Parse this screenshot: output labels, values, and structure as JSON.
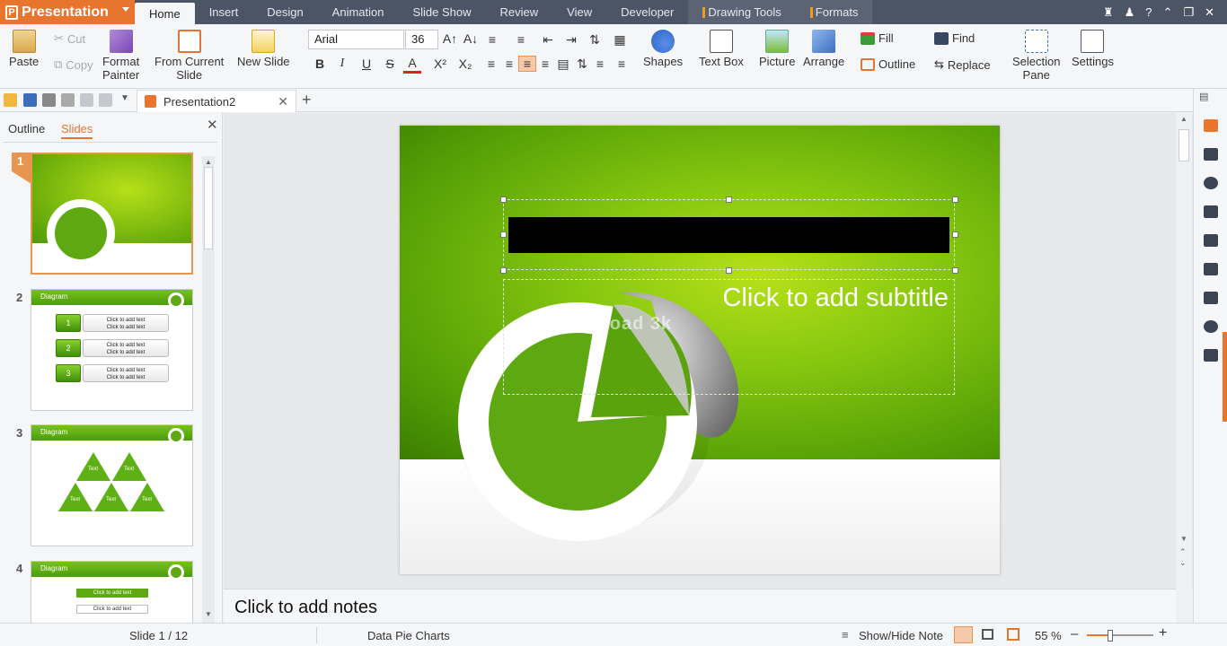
{
  "menubar": {
    "app_name": "Presentation",
    "tabs": [
      "Home",
      "Insert",
      "Design",
      "Animation",
      "Slide Show",
      "Review",
      "View",
      "Developer"
    ],
    "context_tabs": [
      "Drawing Tools",
      "Formats"
    ],
    "active_tab": "Home",
    "help_label": "?"
  },
  "ribbon": {
    "paste": "Paste",
    "cut": "Cut",
    "copy": "Copy",
    "format_painter_1": "Format",
    "format_painter_2": "Painter",
    "from_current_1": "From Current",
    "from_current_2": "Slide",
    "new_slide": "New Slide",
    "font_name": "Arial",
    "font_size": "36",
    "bold": "B",
    "italic": "I",
    "underline": "U",
    "strike": "S",
    "font_color": "A",
    "superscript": "X²",
    "subscript": "X₂",
    "shapes": "Shapes",
    "text_box": "Text Box",
    "picture": "Picture",
    "arrange": "Arrange",
    "fill": "Fill",
    "outline": "Outline",
    "find": "Find",
    "replace": "Replace",
    "selection_pane_1": "Selection",
    "selection_pane_2": "Pane",
    "settings": "Settings"
  },
  "doc": {
    "tab_title": "Presentation2"
  },
  "left_panel": {
    "tabs": [
      "Outline",
      "Slides"
    ],
    "active_tab": "Slides",
    "slides": [
      {
        "number": "1"
      },
      {
        "number": "2",
        "header": "Diagram",
        "items": [
          {
            "num": "1",
            "text": "Click to add text\nClick to add text"
          },
          {
            "num": "2",
            "text": "Click to add text\nClick to add text"
          },
          {
            "num": "3",
            "text": "Click to add text\nClick to add text"
          }
        ]
      },
      {
        "number": "3",
        "header": "Diagram",
        "tri_label": "Text"
      },
      {
        "number": "4",
        "header": "Diagram",
        "items": [
          "Click to add text",
          "Click to add text"
        ]
      }
    ]
  },
  "slide": {
    "subtitle_placeholder": "Click to add subtitle",
    "watermark": "download 3k"
  },
  "notes": {
    "placeholder": "Click to add notes"
  },
  "status": {
    "slide_counter": "Slide 1 / 12",
    "theme_name": "Data Pie Charts",
    "show_hide_note": "Show/Hide Note",
    "zoom": "55 %",
    "zoom_level": 0.55
  },
  "colors": {
    "accent": "#e8742d",
    "menubar": "#4b5566",
    "slide_green": "#6bb80a"
  }
}
